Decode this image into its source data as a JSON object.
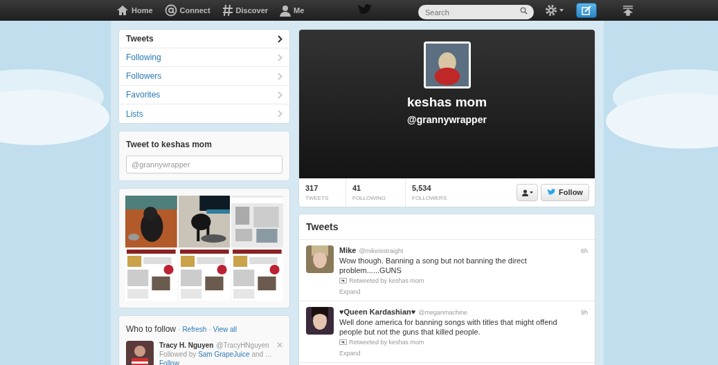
{
  "topbar": {
    "nav": [
      {
        "label": "Home",
        "kind": "home"
      },
      {
        "label": "Connect",
        "kind": "at"
      },
      {
        "label": "Discover",
        "kind": "hash"
      },
      {
        "label": "Me",
        "kind": "person"
      }
    ],
    "search": {
      "placeholder": "Search"
    }
  },
  "profile_nav": [
    {
      "label": "Tweets",
      "selected": true
    },
    {
      "label": "Following",
      "selected": false
    },
    {
      "label": "Followers",
      "selected": false
    },
    {
      "label": "Favorites",
      "selected": false
    },
    {
      "label": "Lists",
      "selected": false
    }
  ],
  "tweet_to": {
    "title": "Tweet to keshas mom",
    "placeholder": "@grannywrapper"
  },
  "who_to_follow": {
    "title": "Who to follow",
    "links": [
      {
        "separator": "·",
        "label": "Refresh"
      },
      {
        "separator": "·",
        "label": "View all"
      }
    ],
    "users": [
      {
        "name": "Tracy H. Nguyen",
        "handle": "@TracyHNguyen",
        "followed_by_prefix": "Followed by",
        "followed_by": "Sam GrapeJuice",
        "followed_by_suffix": "and …",
        "action": "Follow"
      }
    ]
  },
  "profile": {
    "name": "keshas mom",
    "handle": "@grannywrapper",
    "stats": [
      {
        "value": "317",
        "label": "TWEETS"
      },
      {
        "value": "41",
        "label": "FOLLOWING"
      },
      {
        "value": "5,534",
        "label": "FOLLOWERS"
      }
    ],
    "follow_button": "Follow"
  },
  "tweets": {
    "title": "Tweets",
    "items": [
      {
        "name": "Mike",
        "handle": "@mikeisstraight",
        "time": "6h",
        "text": "Wow though. Banning a song but not banning the direct problem......GUNS",
        "retweeted_by": "Retweeted by keshas mom",
        "expand": "Expand"
      },
      {
        "name": "♥Queen Kardashian♥",
        "handle": "@meganmachine",
        "time": "9h",
        "text": "Well done america for banning songs with titles that might offend people but not the guns that killed people.",
        "retweeted_by": "Retweeted by keshas mom",
        "expand": "Expand"
      }
    ]
  }
}
